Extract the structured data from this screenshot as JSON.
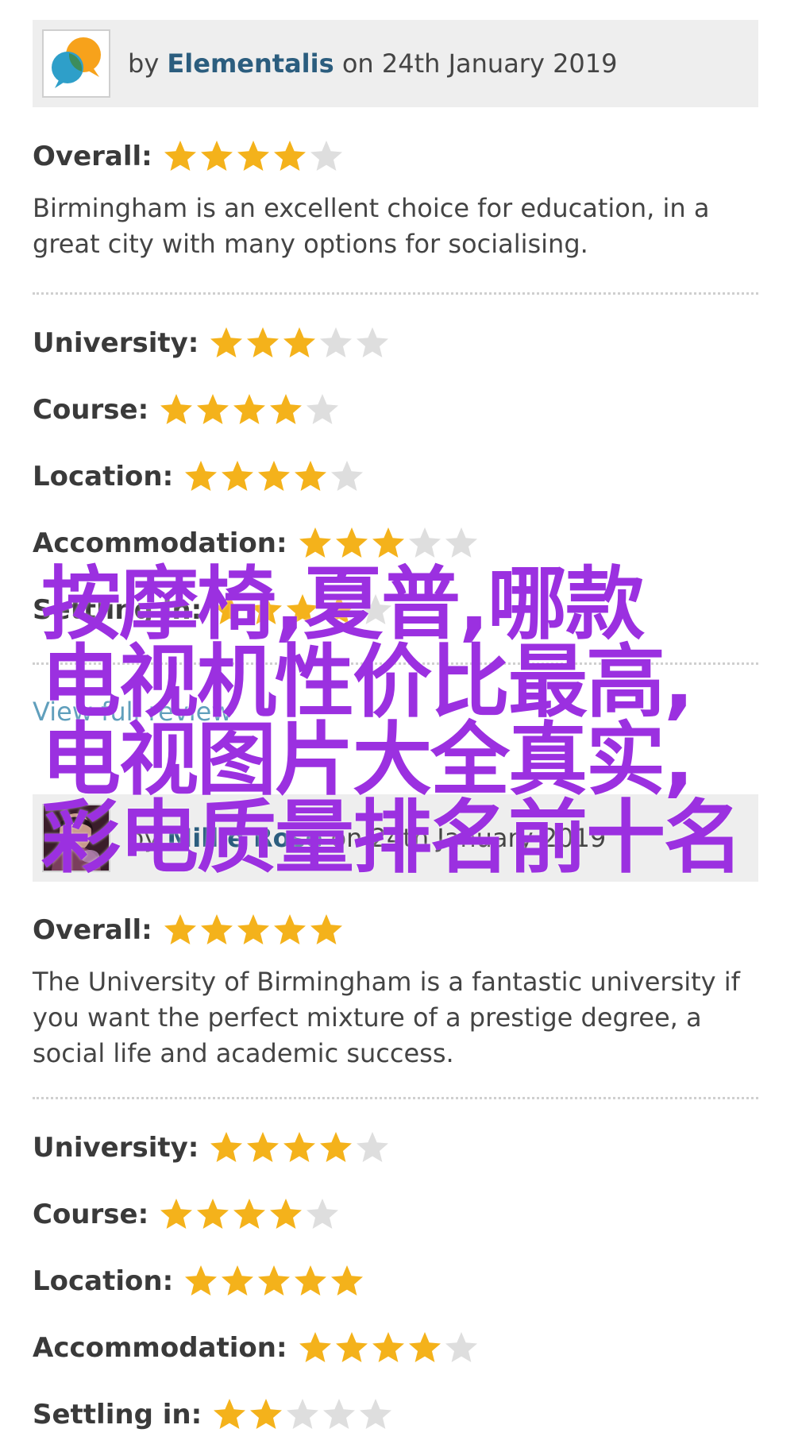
{
  "colors": {
    "star_on": "#f4b21b",
    "star_off": "#dedede",
    "author_link": "#2b5d7e",
    "watermark": "#9b30e0",
    "header_bg": "#eeeeee"
  },
  "reviews": [
    {
      "avatar_icon": "orange-blue-speech-bubbles-avatar",
      "by_prefix": "by",
      "author": "Elementalis",
      "date_text": "on 24th January 2019",
      "overall": {
        "label": "Overall:",
        "stars": 4
      },
      "text": "Birmingham is an excellent choice for education, in a great city with many options for socialising.",
      "ratings": [
        {
          "label": "University:",
          "stars": 3
        },
        {
          "label": "Course:",
          "stars": 4
        },
        {
          "label": "Location:",
          "stars": 4
        },
        {
          "label": "Accommodation:",
          "stars": 3
        },
        {
          "label": "Settling in:",
          "stars": 4
        }
      ],
      "full_review_link": "View full review"
    },
    {
      "avatar_icon": "photo-avatar",
      "by_prefix": "by",
      "author": "Millie Rose",
      "date_text": "on 24th January 2019",
      "overall": {
        "label": "Overall:",
        "stars": 5
      },
      "text": "The University of Birmingham is a fantastic university if you want the perfect mixture of a prestige degree, a social life and academic success.",
      "ratings": [
        {
          "label": "University:",
          "stars": 4
        },
        {
          "label": "Course:",
          "stars": 4
        },
        {
          "label": "Location:",
          "stars": 5
        },
        {
          "label": "Accommodation:",
          "stars": 4
        },
        {
          "label": "Settling in:",
          "stars": 2
        }
      ]
    }
  ],
  "watermark": {
    "lines": [
      "按摩椅,夏普,哪款",
      "电视机性价比最高,",
      "电视图片大全真实,",
      "彩电质量排名前十名"
    ]
  }
}
